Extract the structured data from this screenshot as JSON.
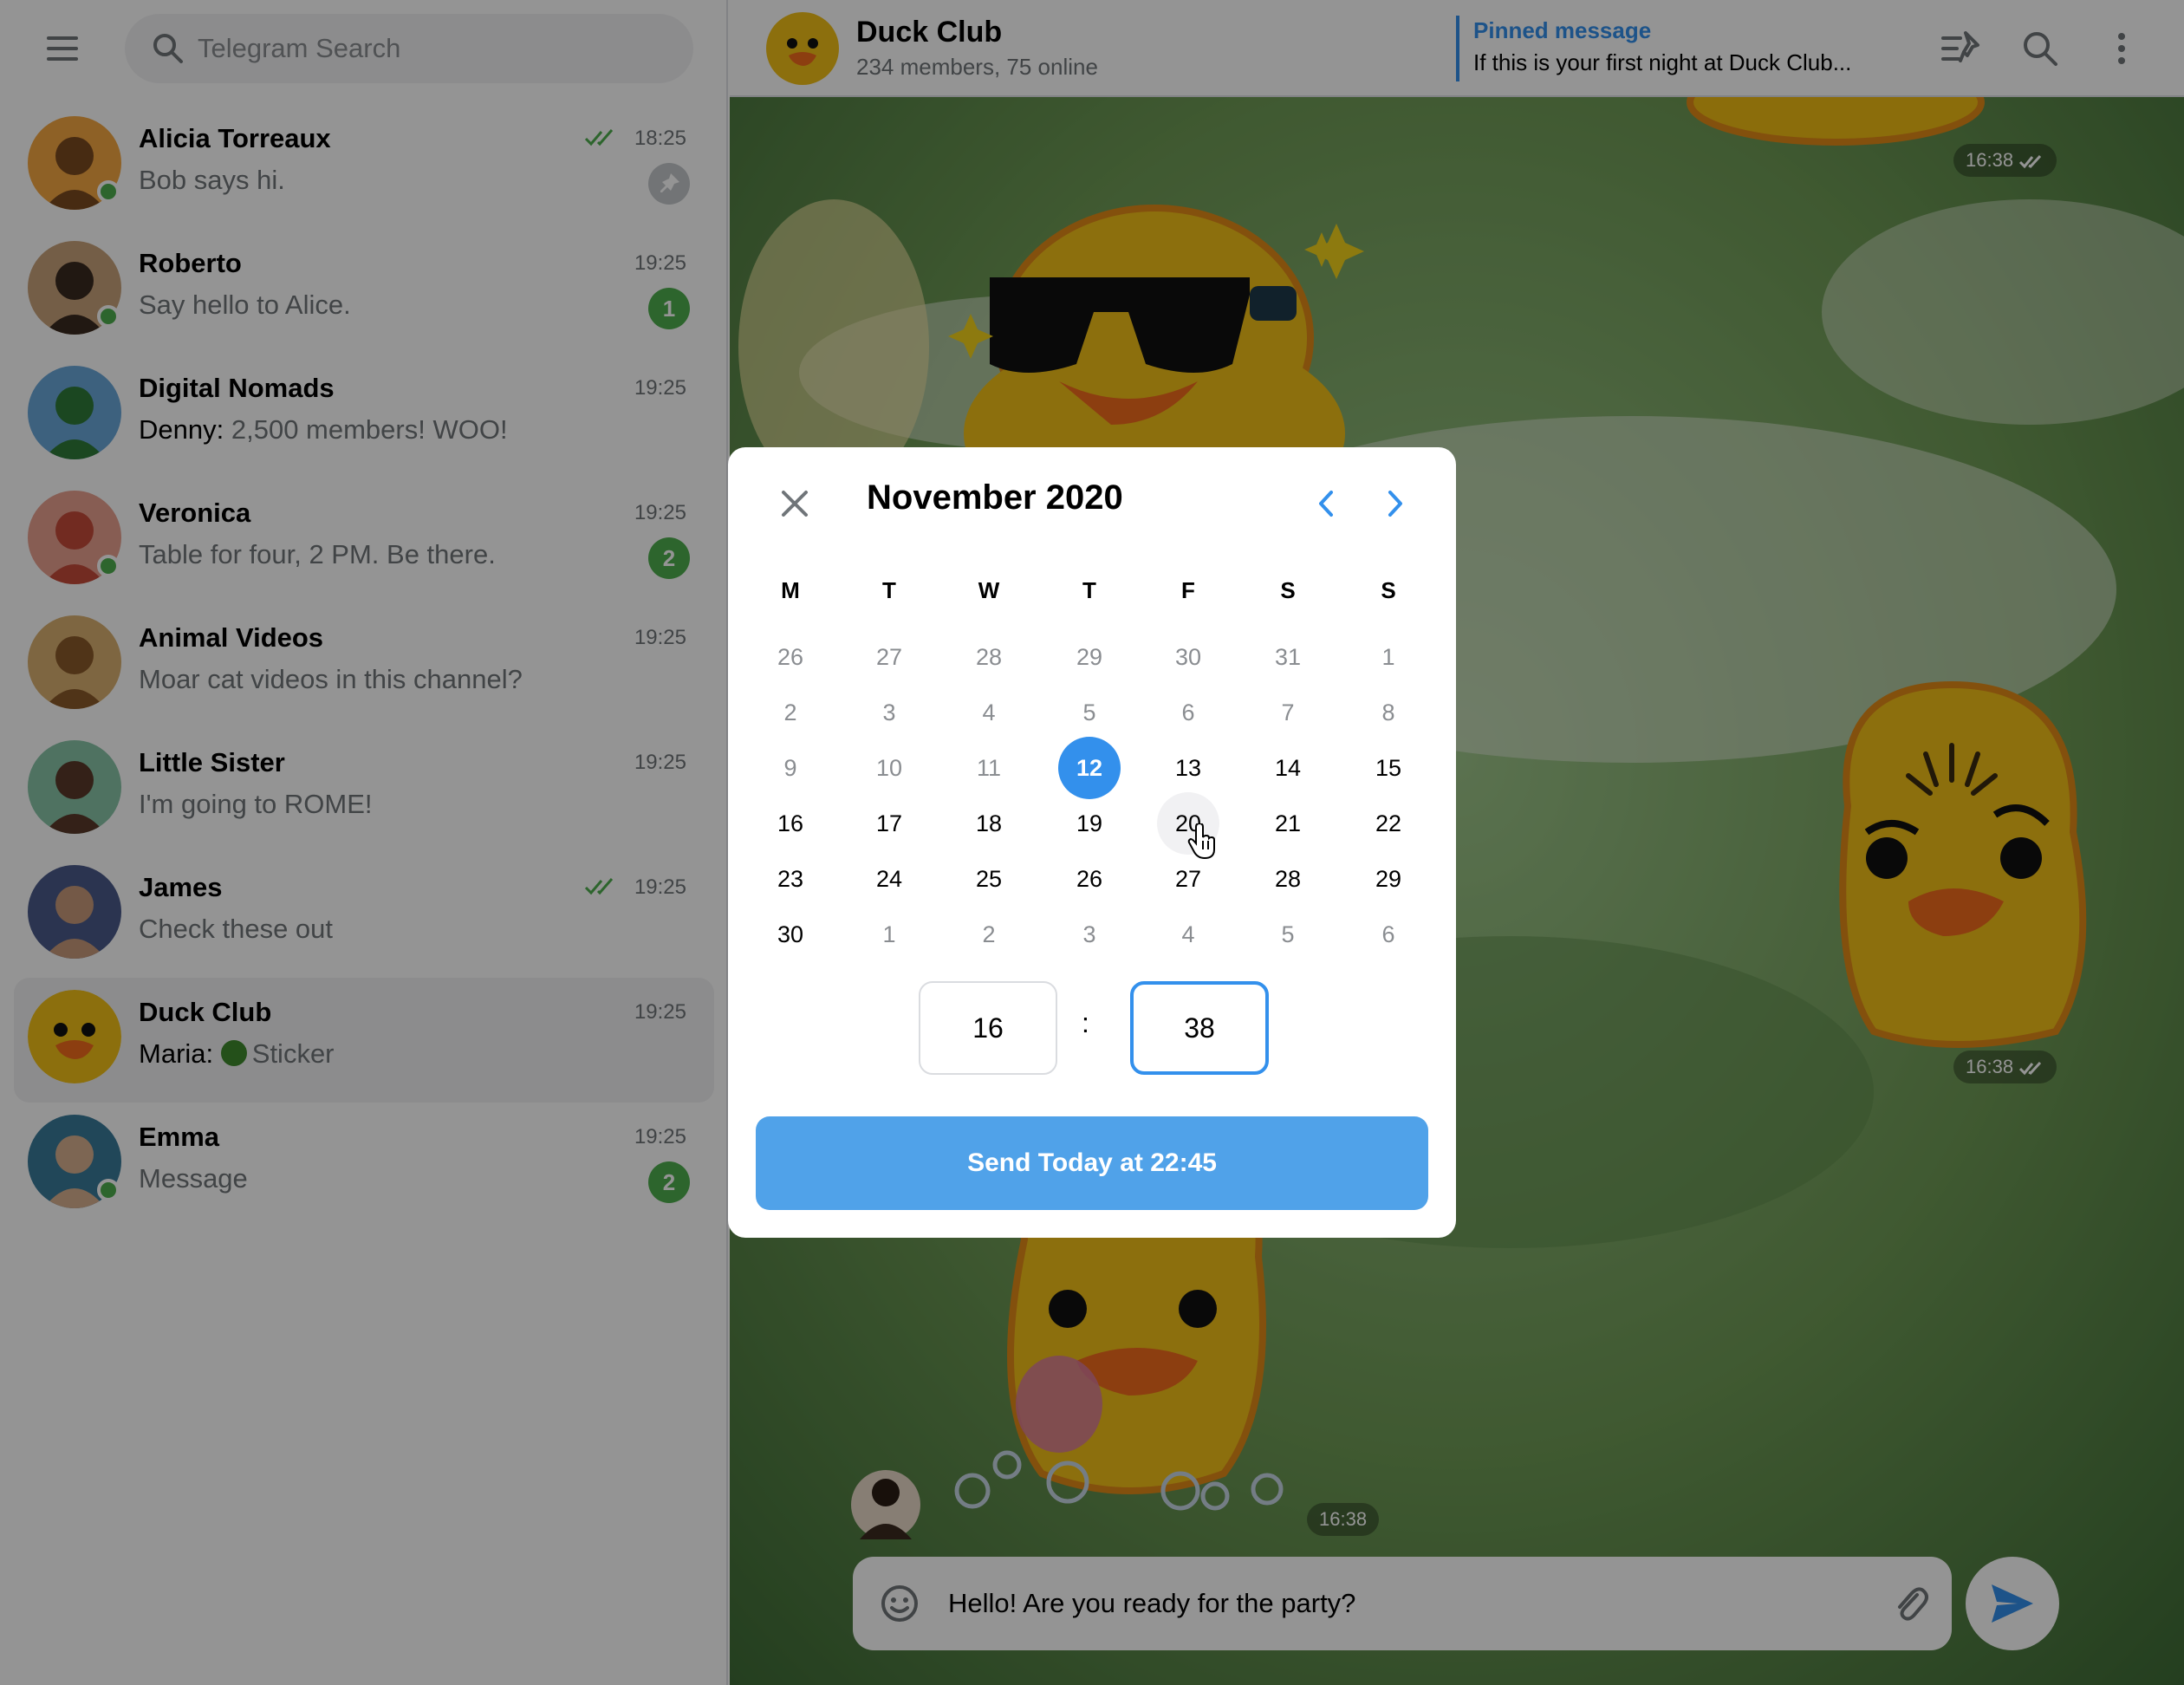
{
  "sidebar": {
    "search_placeholder": "Telegram Search",
    "chats": [
      {
        "name": "Alicia Torreaux",
        "time": "18:25",
        "sender": "",
        "preview": "Bob says hi.",
        "badge": "",
        "pinned": true,
        "read": true,
        "online": true
      },
      {
        "name": "Roberto",
        "time": "19:25",
        "sender": "",
        "preview": "Say hello to Alice.",
        "badge": "1",
        "pinned": false,
        "read": false,
        "online": true
      },
      {
        "name": "Digital Nomads",
        "time": "19:25",
        "sender": "Denny:",
        "preview": "2,500 members! WOO!",
        "badge": "",
        "pinned": false,
        "read": false,
        "online": false
      },
      {
        "name": "Veronica",
        "time": "19:25",
        "sender": "",
        "preview": "Table for four, 2 PM. Be there.",
        "badge": "2",
        "pinned": false,
        "read": false,
        "online": true
      },
      {
        "name": "Animal Videos",
        "time": "19:25",
        "sender": "",
        "preview": "Moar cat videos in this channel?",
        "badge": "",
        "pinned": false,
        "read": false,
        "online": false
      },
      {
        "name": "Little Sister",
        "time": "19:25",
        "sender": "",
        "preview": "I'm going to ROME!",
        "badge": "",
        "pinned": false,
        "read": false,
        "online": false
      },
      {
        "name": "James",
        "time": "19:25",
        "sender": "",
        "preview": "Check these out",
        "badge": "",
        "pinned": false,
        "read": true,
        "online": false
      },
      {
        "name": "Duck Club",
        "time": "19:25",
        "sender": "Maria:",
        "preview": "Sticker",
        "badge": "",
        "pinned": false,
        "read": false,
        "online": false
      },
      {
        "name": "Emma",
        "time": "19:25",
        "sender": "",
        "preview": "Message",
        "badge": "2",
        "pinned": false,
        "read": false,
        "online": true
      }
    ]
  },
  "header": {
    "title": "Duck Club",
    "subtitle": "234 members, 75 online",
    "pinned_title": "Pinned message",
    "pinned_text": "If this is your first night at Duck Club..."
  },
  "messages": {
    "time_1": "16:38",
    "time_2": "16:38",
    "time_3": "16:38"
  },
  "composer": {
    "value": "Hello! Are you ready for the party?"
  },
  "calendar": {
    "month_title": "November 2020",
    "weekdays": [
      "M",
      "T",
      "W",
      "T",
      "F",
      "S",
      "S"
    ],
    "weeks": [
      [
        "26",
        "27",
        "28",
        "29",
        "30",
        "31",
        "1"
      ],
      [
        "2",
        "3",
        "4",
        "5",
        "6",
        "7",
        "8"
      ],
      [
        "9",
        "10",
        "11",
        "12",
        "13",
        "14",
        "15"
      ],
      [
        "16",
        "17",
        "18",
        "19",
        "20",
        "21",
        "22"
      ],
      [
        "23",
        "24",
        "25",
        "26",
        "27",
        "28",
        "29"
      ],
      [
        "30",
        "1",
        "2",
        "3",
        "4",
        "5",
        "6"
      ]
    ],
    "muted_days": [
      "0.0",
      "0.1",
      "0.2",
      "0.3",
      "0.4",
      "0.5",
      "0.6",
      "1.0",
      "1.1",
      "1.2",
      "1.3",
      "1.4",
      "1.5",
      "1.6",
      "2.0",
      "2.1",
      "2.2",
      "5.1",
      "5.2",
      "5.3",
      "5.4",
      "5.5",
      "5.6"
    ],
    "selected_day": "2.3",
    "hovered_day": "3.4",
    "hour": "16",
    "colon": ":",
    "minute": "38",
    "send_label": "Send Today at 22:45"
  },
  "colors": {
    "accent": "#3390ec",
    "online": "#4fae4e",
    "unread_badge": "#4fae4e",
    "send_button": "#50a2e9"
  }
}
